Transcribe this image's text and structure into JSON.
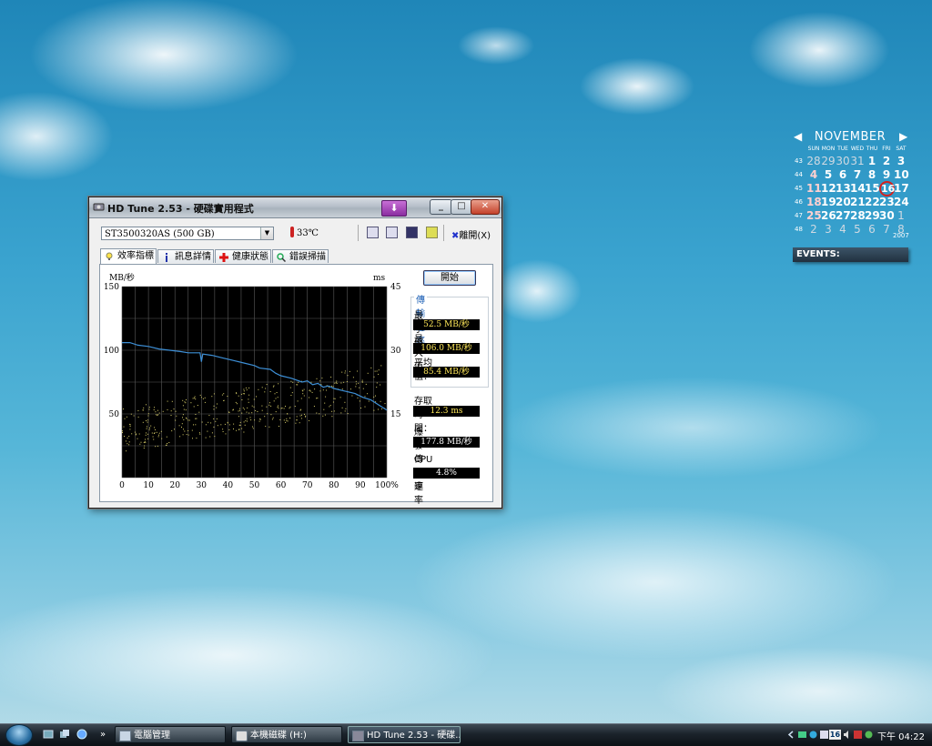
{
  "window": {
    "title": "HD Tune 2.53 - 硬碟實用程式",
    "drive": "ST3500320AS (500 GB)",
    "temperature": "33℃",
    "exit_label": "離開(X)",
    "tabs": [
      {
        "label": "效率指標",
        "active": true
      },
      {
        "label": "訊息詳情",
        "active": false
      },
      {
        "label": "健康狀態",
        "active": false
      },
      {
        "label": "錯誤掃描",
        "active": false
      }
    ],
    "start_button": "開始",
    "transfer_group": "傳輸速率",
    "min_label": "最小值",
    "min_value": "52.5 MB/秒",
    "max_label": "最大值",
    "max_value": "106.0 MB/秒",
    "avg_label": "平均值：",
    "avg_value": "85.4 MB/秒",
    "access_label": "存取時間：",
    "access_value": "12.3 ms",
    "burst_label": "爆發傳輸速率",
    "burst_value": "177.8 MB/秒",
    "cpu_label": "CPU 使用率",
    "cpu_value": "4.8%"
  },
  "chart_data": {
    "type": "line",
    "ylabel": "MB/秒",
    "y2label": "ms",
    "xlim": [
      0,
      100
    ],
    "ylim": [
      0,
      150
    ],
    "y2lim": [
      0,
      45
    ],
    "x_ticks": [
      "0",
      "10",
      "20",
      "30",
      "40",
      "50",
      "60",
      "70",
      "80",
      "90",
      "100%"
    ],
    "y_ticks": [
      "150",
      "100",
      "50"
    ],
    "y2_ticks": [
      "45",
      "30",
      "15"
    ],
    "series": [
      {
        "name": "",
        "axis": "left",
        "x": [
          0,
          3,
          6,
          10,
          14,
          18,
          22,
          25,
          28,
          29.5,
          30,
          30.5,
          34,
          38,
          42,
          46,
          50,
          52,
          56,
          58,
          60,
          64,
          68,
          70,
          72,
          74,
          76,
          78,
          80,
          84,
          88,
          91,
          94,
          97,
          100
        ],
        "y": [
          106,
          106,
          104,
          103,
          101,
          100,
          99,
          98,
          98,
          98,
          91,
          97,
          96,
          94,
          92,
          90,
          88,
          86,
          85,
          82,
          80,
          78,
          75,
          76,
          73,
          74,
          71,
          72,
          70,
          68,
          66,
          63,
          61,
          57,
          53
        ]
      }
    ],
    "access_time": {
      "axis": "right",
      "y_range_ms": [
        6,
        25
      ],
      "trend": "rising with disk position",
      "average_ms": 12.3
    }
  },
  "calendar": {
    "month": "NOVEMBER",
    "year": "2007",
    "prev": "◀",
    "next": "▶",
    "dows": [
      "SUN",
      "MON",
      "TUE",
      "WED",
      "THU",
      "FRI",
      "SAT"
    ],
    "weeks": [
      {
        "wk": "43",
        "days": [
          "28",
          "29",
          "30",
          "31",
          "1",
          "2",
          "3"
        ]
      },
      {
        "wk": "44",
        "days": [
          "4",
          "5",
          "6",
          "7",
          "8",
          "9",
          "10"
        ]
      },
      {
        "wk": "45",
        "days": [
          "11",
          "12",
          "13",
          "14",
          "15",
          "16",
          "17"
        ]
      },
      {
        "wk": "46",
        "days": [
          "18",
          "19",
          "20",
          "21",
          "22",
          "23",
          "24"
        ]
      },
      {
        "wk": "47",
        "days": [
          "25",
          "26",
          "27",
          "28",
          "29",
          "30",
          "1"
        ]
      },
      {
        "wk": "48",
        "days": [
          "2",
          "3",
          "4",
          "5",
          "6",
          "7",
          "8"
        ]
      }
    ],
    "today": "16",
    "events_label": "EVENTS:"
  },
  "taskbar": {
    "tasks": [
      "電腦管理",
      "本機磁碟 (H:)",
      "HD Tune 2.53 - 硬碟..."
    ],
    "tray_badge": "16",
    "clock": "下午 04:22",
    "more": "»"
  }
}
